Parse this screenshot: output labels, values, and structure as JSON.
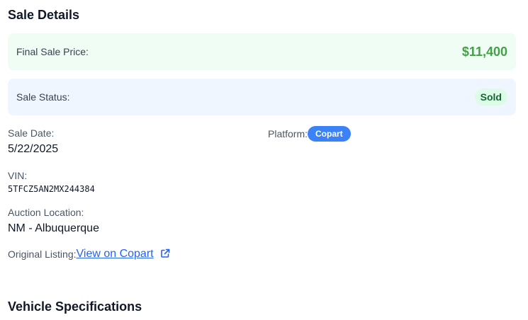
{
  "sale_details": {
    "title": "Sale Details",
    "final_price_label": "Final Sale Price:",
    "final_price_value": "$11,400",
    "status_label": "Sale Status:",
    "status_value": "Sold",
    "sale_date_label": "Sale Date:",
    "sale_date_value": "5/22/2025",
    "platform_label": "Platform:",
    "platform_value": "Copart",
    "vin_label": "VIN:",
    "vin_value": "5TFCZ5AN2MX244384",
    "location_label": "Auction Location:",
    "location_value": "NM - Albuquerque",
    "listing_label": "Original Listing:",
    "listing_link_text": "View on Copart",
    "listing_icon": "external-link-icon"
  },
  "vehicle_specs": {
    "title": "Vehicle Specifications"
  },
  "colors": {
    "price_green": "#43a047",
    "price_bg": "#f0fdf4",
    "status_bg": "#eff6ff",
    "badge_blue": "#3b82f6",
    "link_blue": "#2563eb"
  }
}
